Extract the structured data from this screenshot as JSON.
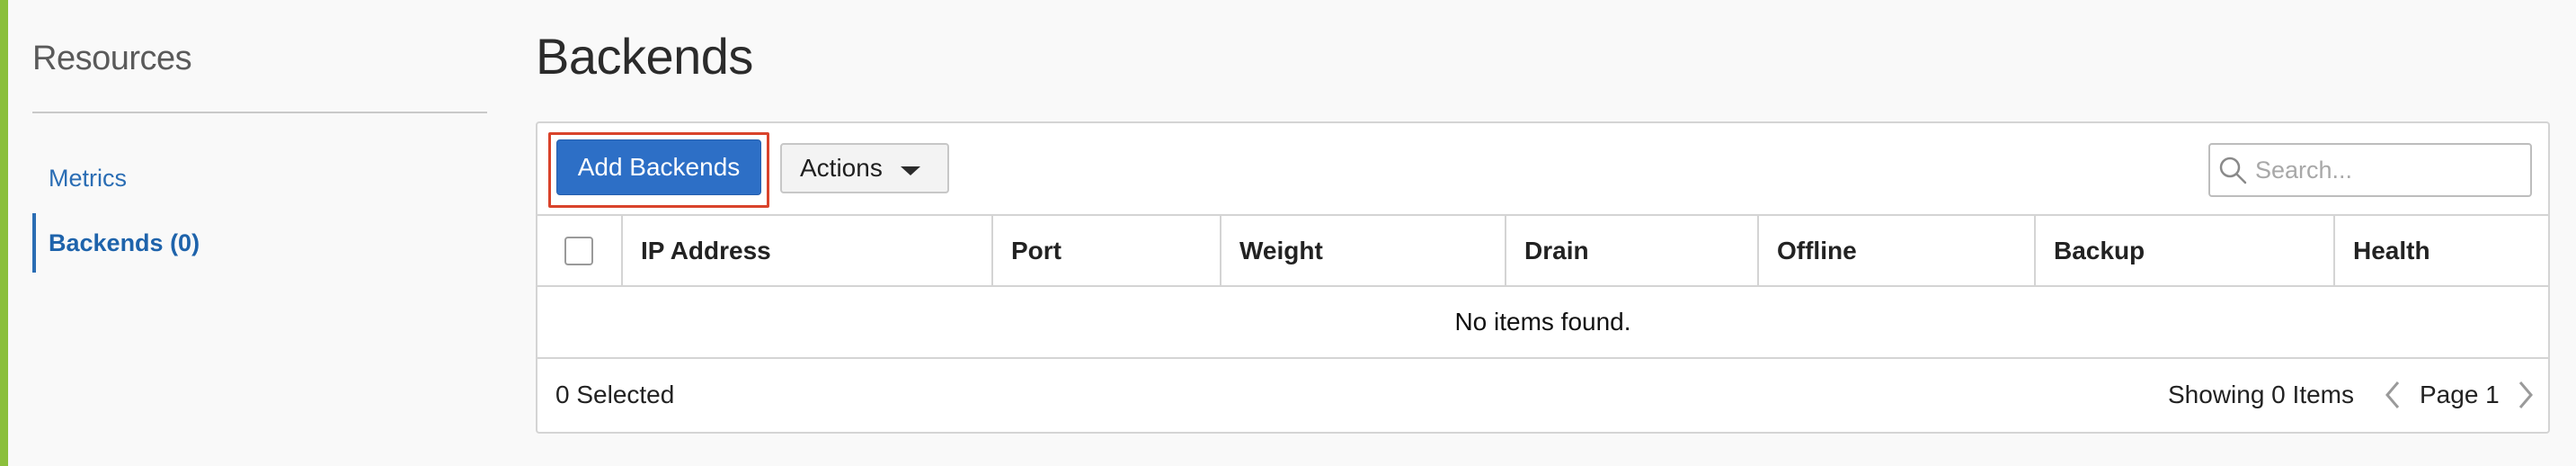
{
  "sidebar": {
    "title": "Resources",
    "items": [
      {
        "label": "Metrics",
        "active": false
      },
      {
        "label": "Backends (0)",
        "active": true
      }
    ]
  },
  "main": {
    "title": "Backends",
    "toolbar": {
      "add_label": "Add Backends",
      "actions_label": "Actions",
      "search_placeholder": "Search..."
    },
    "table": {
      "columns": [
        "IP Address",
        "Port",
        "Weight",
        "Drain",
        "Offline",
        "Backup",
        "Health"
      ],
      "empty_message": "No items found.",
      "selected_text": "0 Selected",
      "showing_text": "Showing 0 Items",
      "page_text": "Page 1"
    }
  },
  "colors": {
    "accent": "#8bbf3c",
    "primary": "#2d6fc6",
    "link": "#2a6db4",
    "highlight": "#d9432b"
  },
  "icons": [
    "search-icon",
    "caret-down-icon",
    "chevron-left-icon",
    "chevron-right-icon"
  ]
}
